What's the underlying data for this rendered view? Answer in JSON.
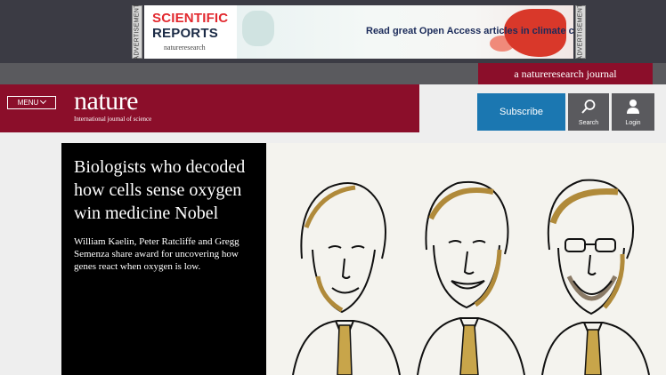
{
  "ad": {
    "side_label": "ADVERTISEMENT",
    "brand_line1": "SCIENTIFIC",
    "brand_line2": "REPORTS",
    "brand_line3": "natureresearch",
    "tagline": "Read great Open Access articles in climate change"
  },
  "journal_tag": "a natureresearch journal",
  "header": {
    "menu_label": "MENU",
    "logo_word": "nature",
    "logo_tagline": "International journal of science",
    "subscribe_label": "Subscribe",
    "search_label": "Search",
    "login_label": "Login"
  },
  "hero": {
    "title": "Biologists who decoded how cells sense oxygen win medicine Nobel",
    "description": "William Kaelin, Peter Ratcliffe and Gregg Semenza share award for uncovering how genes react when oxygen is low."
  },
  "colors": {
    "brand": "#8b0e2a",
    "subscribe": "#1b77b1",
    "ad_band": "#3b3b44"
  }
}
